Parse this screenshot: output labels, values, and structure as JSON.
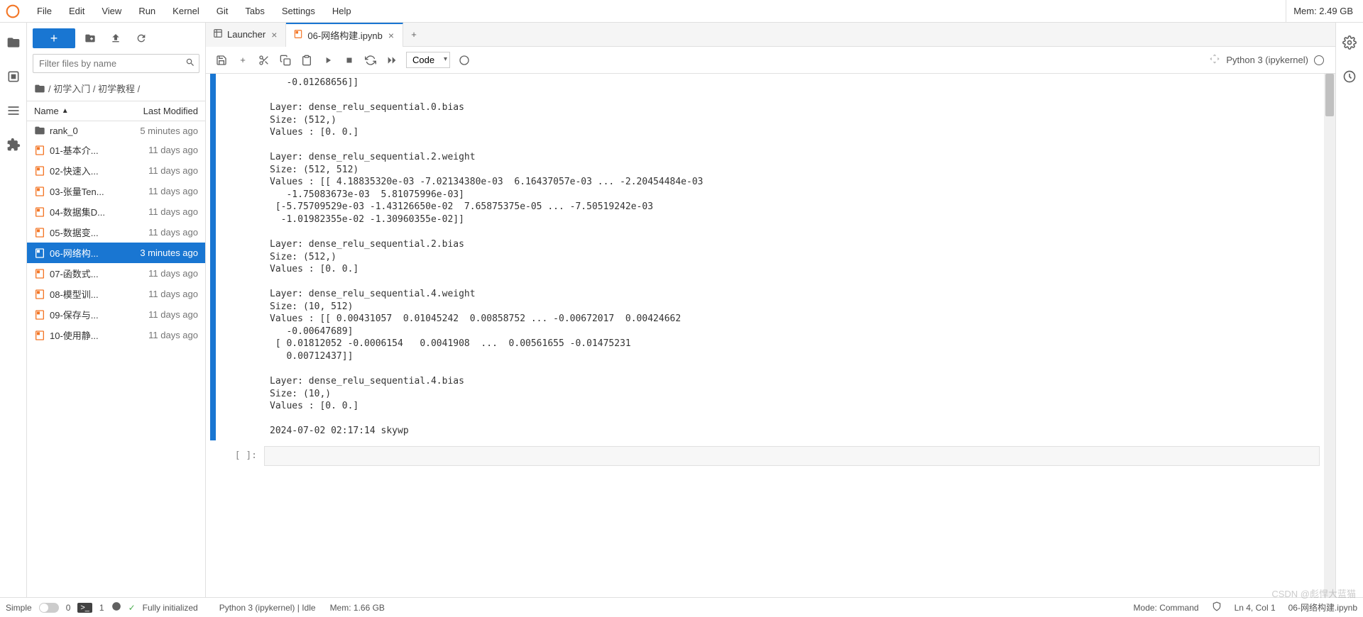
{
  "menu": {
    "items": [
      "File",
      "Edit",
      "View",
      "Run",
      "Kernel",
      "Git",
      "Tabs",
      "Settings",
      "Help"
    ],
    "mem": "Mem: 2.49 GB"
  },
  "filebrowser": {
    "filter_placeholder": "Filter files by name",
    "breadcrumb": [
      "/",
      "初学入门",
      "/",
      "初学教程",
      "/"
    ],
    "header_name": "Name",
    "header_modified": "Last Modified",
    "files": [
      {
        "name": "rank_0",
        "type": "folder",
        "modified": "5 minutes ago",
        "selected": false
      },
      {
        "name": "01-基本介...",
        "type": "notebook",
        "modified": "11 days ago",
        "selected": false
      },
      {
        "name": "02-快速入...",
        "type": "notebook",
        "modified": "11 days ago",
        "selected": false
      },
      {
        "name": "03-张量Ten...",
        "type": "notebook",
        "modified": "11 days ago",
        "selected": false
      },
      {
        "name": "04-数据集D...",
        "type": "notebook",
        "modified": "11 days ago",
        "selected": false
      },
      {
        "name": "05-数据变...",
        "type": "notebook",
        "modified": "11 days ago",
        "selected": false
      },
      {
        "name": "06-网络构...",
        "type": "notebook",
        "modified": "3 minutes ago",
        "selected": true
      },
      {
        "name": "07-函数式...",
        "type": "notebook",
        "modified": "11 days ago",
        "selected": false
      },
      {
        "name": "08-模型训...",
        "type": "notebook",
        "modified": "11 days ago",
        "selected": false
      },
      {
        "name": "09-保存与...",
        "type": "notebook",
        "modified": "11 days ago",
        "selected": false
      },
      {
        "name": "10-使用静...",
        "type": "notebook",
        "modified": "11 days ago",
        "selected": false
      }
    ]
  },
  "tabs": [
    {
      "label": "Launcher",
      "icon": "launcher",
      "active": false
    },
    {
      "label": "06-网络构建.ipynb",
      "icon": "notebook",
      "active": true
    }
  ],
  "toolbar": {
    "cell_type": "Code",
    "kernel_name": "Python 3 (ipykernel)"
  },
  "output": "   -0.01268656]]\n\nLayer: dense_relu_sequential.0.bias\nSize: (512,)\nValues : [0. 0.]\n\nLayer: dense_relu_sequential.2.weight\nSize: (512, 512)\nValues : [[ 4.18835320e-03 -7.02134380e-03  6.16437057e-03 ... -2.20454484e-03\n   -1.75083673e-03  5.81075996e-03]\n [-5.75709529e-03 -1.43126650e-02  7.65875375e-05 ... -7.50519242e-03\n  -1.01982355e-02 -1.30960355e-02]]\n\nLayer: dense_relu_sequential.2.bias\nSize: (512,)\nValues : [0. 0.]\n\nLayer: dense_relu_sequential.4.weight\nSize: (10, 512)\nValues : [[ 0.00431057  0.01045242  0.00858752 ... -0.00672017  0.00424662\n   -0.00647689]\n [ 0.01812052 -0.0006154   0.0041908  ...  0.00561655 -0.01475231\n   0.00712437]]\n\nLayer: dense_relu_sequential.4.bias\nSize: (10,)\nValues : [0. 0.]\n\n2024-07-02 02:17:14 skywp",
  "empty_prompt": "[ ]:",
  "status": {
    "simple": "Simple",
    "terminals_0": "0",
    "terminals_1": "1",
    "init": "Fully initialized",
    "kernel": "Python 3 (ipykernel) | Idle",
    "mem": "Mem: 1.66 GB",
    "mode": "Mode: Command",
    "pos": "Ln 4, Col 1",
    "file": "06-网络构建.ipynb"
  },
  "watermark": "CSDN @彪悍大蓝猫"
}
